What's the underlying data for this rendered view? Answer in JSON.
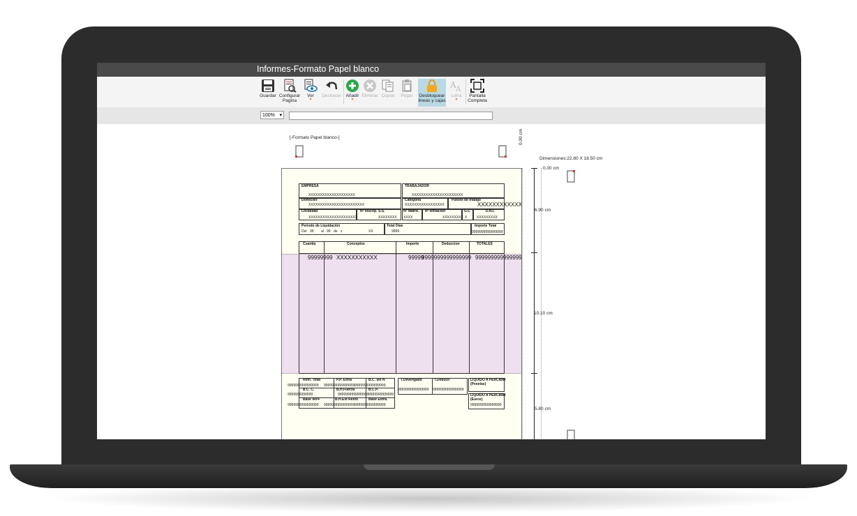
{
  "window": {
    "title": "Informes-Formato Papel blanco"
  },
  "toolbar": {
    "guardar": "Guardar",
    "configurar_1": "Configurar",
    "configurar_2": "Pagina",
    "ver": "Ver",
    "deshacer": "Deshacer",
    "anadir": "Añadir",
    "eliminar": "Eliminar",
    "copiar": "Copiar",
    "pegar": "Pegar",
    "desbloquear_1": "Desbloquear",
    "desbloquear_2": "lineas y cajas",
    "letra": "Letra",
    "pantalla_1": "Pantalla",
    "pantalla_2": "Completa"
  },
  "zoom": {
    "value": "100%"
  },
  "canvas": {
    "format_label": "[-Formato Papel blanco-]",
    "top_ruler": "0.00  cm",
    "dimensions": "Dimensiones:22.80 X 18.50 cm",
    "rulers": [
      "0.00 cm",
      "6.90 cm",
      "10.10 cm",
      "5.80 cm"
    ]
  },
  "form": {
    "empresa": "EMPRESA",
    "empresa_val": "XXXXXXXXXXXXXXXXXXXX",
    "trabajador": "TRABAJADOR",
    "trabajador_val": "XXXXXXXXXXXXXXXXXXXXXX",
    "domicilio": "Domicilio",
    "domicilio_val": "XXXXXXXXXXXXXXXXXXXXXXXX",
    "categoria": "Categoria",
    "categoria_val": "XXXXXXXXXXXXXXXXX",
    "puesto": "Puesto de trabajo",
    "puesto_val": "XXXXXXXXXXXX",
    "localidad": "Localidad",
    "localidad_val": "XXXXXXXXXXXXXXXXXXXXX",
    "inscrip": "Nº Inscrip. S.S.",
    "inscrip_val": "XXXXXXXX",
    "matric": "Nº Matric.",
    "matric_val": "XXXX",
    "afiliacion": "Nº Afiliacion",
    "afiliacion_val": "XXXXXXXXX",
    "gc": "G.C",
    "gc_val": "X",
    "dni": "D.N.I.",
    "dni_val": "XXXXXXXXX",
    "periodo": "Periodo de Liquidación",
    "del": "Del",
    "del_v": "99",
    "al": "al",
    "al_v": "99",
    "de": "de",
    "de_v": "x",
    "xx": "XX",
    "total_dias": "Total Días",
    "total_dias_val": "9999",
    "importe_total": "Importe Total",
    "importe_total_val": "9999999999999999",
    "cuantia": "Cuantia",
    "conceptos": "Conceptos",
    "importe": "Importe",
    "deduccion": "Deduccion",
    "totales": "TOTALES",
    "row_cuantia": "99999999",
    "row_concepto": "XXXXXXXXXXX",
    "row_importe": "99999",
    "row_deduccion": "9999999999999999",
    "row_total": "9999999999999999",
    "rem_total": "Rem. Total",
    "pp_extra": "P.P. Extra",
    "bc_sin_n": "B.C. sin N",
    "t_devengado": "T.Devengado",
    "t_deducir": "T.Deducir",
    "liq_pesetas_1": "LIQUIDO A PERCIBIR",
    "liq_pesetas_2": "(Pesetas)",
    "liq_euros_1": "LIQUIDO A PERCIBIR",
    "liq_euros_2": "(Euros)",
    "bc_c": "B.C. C.",
    "bh_fuerza": "B.H.Fuerza",
    "bc_p": "B.C.P.",
    "base_irpf": "Base IRPF",
    "bh_ext_resto": "B.H.Ext Resto",
    "base_extra": "Base Extra.",
    "num9": "9999999999999999",
    "num9s": "9999999999999"
  }
}
